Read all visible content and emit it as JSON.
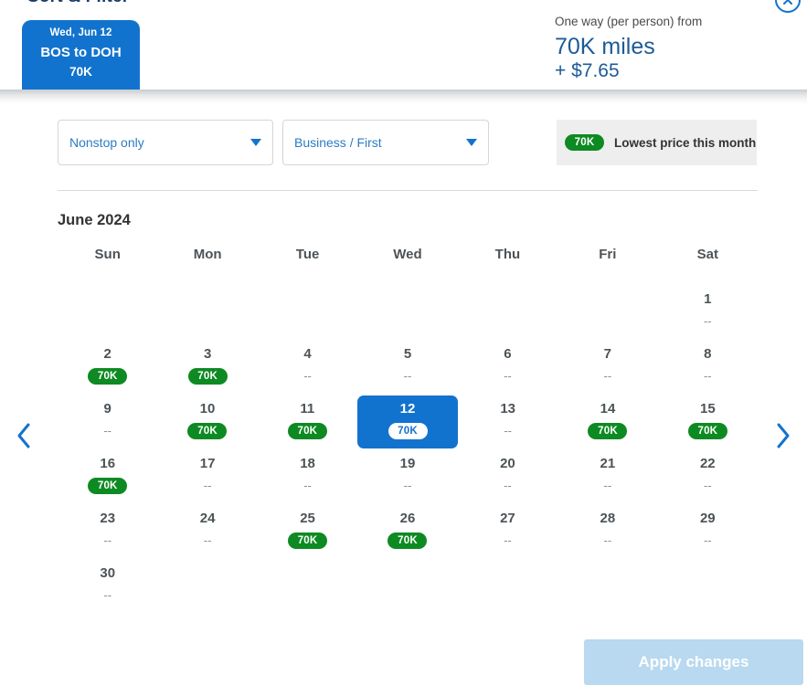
{
  "header": {
    "clipped_title": "Sort & Filter",
    "flight_tab": {
      "date": "Wed, Jun 12",
      "route": "BOS to DOH",
      "price": "70K"
    },
    "price_summary": {
      "caption": "One way (per person) from",
      "miles": "70K miles",
      "cash": "+ $7.65"
    },
    "close_icon": "close-circle-icon"
  },
  "filters": {
    "stops": {
      "label": "Nonstop only",
      "caret_icon": "chevron-down-icon"
    },
    "cabin": {
      "label": "Business / First",
      "caret_icon": "chevron-down-icon"
    },
    "lowest_price": {
      "badge": "70K",
      "text": "Lowest price this month"
    }
  },
  "calendar": {
    "month_title": "June 2024",
    "weekdays": [
      "Sun",
      "Mon",
      "Tue",
      "Wed",
      "Thu",
      "Fri",
      "Sat"
    ],
    "empty_value": "--",
    "weeks": [
      [
        {
          "day": "",
          "value": "",
          "empty": true
        },
        {
          "day": "",
          "value": "",
          "empty": true
        },
        {
          "day": "",
          "value": "",
          "empty": true
        },
        {
          "day": "",
          "value": "",
          "empty": true
        },
        {
          "day": "",
          "value": "",
          "empty": true
        },
        {
          "day": "",
          "value": "",
          "empty": true
        },
        {
          "day": "1",
          "value": "--",
          "badge": false,
          "selected": false
        }
      ],
      [
        {
          "day": "2",
          "value": "70K",
          "badge": true,
          "selected": false
        },
        {
          "day": "3",
          "value": "70K",
          "badge": true,
          "selected": false
        },
        {
          "day": "4",
          "value": "--",
          "badge": false,
          "selected": false
        },
        {
          "day": "5",
          "value": "--",
          "badge": false,
          "selected": false
        },
        {
          "day": "6",
          "value": "--",
          "badge": false,
          "selected": false
        },
        {
          "day": "7",
          "value": "--",
          "badge": false,
          "selected": false
        },
        {
          "day": "8",
          "value": "--",
          "badge": false,
          "selected": false
        }
      ],
      [
        {
          "day": "9",
          "value": "--",
          "badge": false,
          "selected": false
        },
        {
          "day": "10",
          "value": "70K",
          "badge": true,
          "selected": false
        },
        {
          "day": "11",
          "value": "70K",
          "badge": true,
          "selected": false
        },
        {
          "day": "12",
          "value": "70K",
          "badge": true,
          "selected": true
        },
        {
          "day": "13",
          "value": "--",
          "badge": false,
          "selected": false
        },
        {
          "day": "14",
          "value": "70K",
          "badge": true,
          "selected": false
        },
        {
          "day": "15",
          "value": "70K",
          "badge": true,
          "selected": false
        }
      ],
      [
        {
          "day": "16",
          "value": "70K",
          "badge": true,
          "selected": false
        },
        {
          "day": "17",
          "value": "--",
          "badge": false,
          "selected": false
        },
        {
          "day": "18",
          "value": "--",
          "badge": false,
          "selected": false
        },
        {
          "day": "19",
          "value": "--",
          "badge": false,
          "selected": false
        },
        {
          "day": "20",
          "value": "--",
          "badge": false,
          "selected": false
        },
        {
          "day": "21",
          "value": "--",
          "badge": false,
          "selected": false
        },
        {
          "day": "22",
          "value": "--",
          "badge": false,
          "selected": false
        }
      ],
      [
        {
          "day": "23",
          "value": "--",
          "badge": false,
          "selected": false
        },
        {
          "day": "24",
          "value": "--",
          "badge": false,
          "selected": false
        },
        {
          "day": "25",
          "value": "70K",
          "badge": true,
          "selected": false
        },
        {
          "day": "26",
          "value": "70K",
          "badge": true,
          "selected": false
        },
        {
          "day": "27",
          "value": "--",
          "badge": false,
          "selected": false
        },
        {
          "day": "28",
          "value": "--",
          "badge": false,
          "selected": false
        },
        {
          "day": "29",
          "value": "--",
          "badge": false,
          "selected": false
        }
      ],
      [
        {
          "day": "30",
          "value": "--",
          "badge": false,
          "selected": false
        },
        {
          "day": "",
          "value": "",
          "empty": true
        },
        {
          "day": "",
          "value": "",
          "empty": true
        },
        {
          "day": "",
          "value": "",
          "empty": true
        },
        {
          "day": "",
          "value": "",
          "empty": true
        },
        {
          "day": "",
          "value": "",
          "empty": true
        },
        {
          "day": "",
          "value": "",
          "empty": true
        }
      ]
    ],
    "prev_icon": "chevron-left-icon",
    "next_icon": "chevron-right-icon"
  },
  "footer": {
    "apply_label": "Apply changes"
  },
  "colors": {
    "brand_blue": "#1273ce",
    "deep_blue": "#1d5b96",
    "badge_green": "#0e8a23",
    "disabled_blue": "#b8d9ef",
    "muted_gray": "#8b9094"
  }
}
